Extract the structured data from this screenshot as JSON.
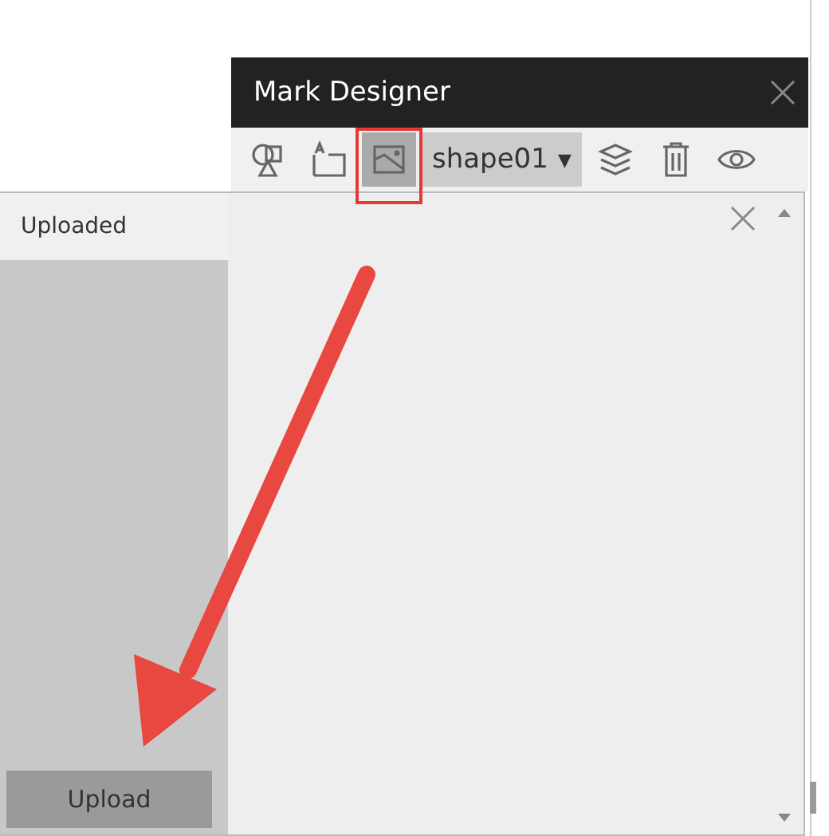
{
  "window": {
    "title": "Mark Designer"
  },
  "toolbar": {
    "tools": [
      {
        "kind": "shapes",
        "selected": false
      },
      {
        "kind": "text",
        "selected": false
      },
      {
        "kind": "image",
        "selected": true
      }
    ],
    "dropdown": {
      "value": "shape01",
      "caret": "▼"
    },
    "actions": [
      {
        "kind": "layers"
      },
      {
        "kind": "delete"
      },
      {
        "kind": "preview"
      }
    ]
  },
  "panel": {
    "title": "Uploaded",
    "button": "Upload"
  },
  "annotation": {
    "highlight": true,
    "arrow": true
  }
}
